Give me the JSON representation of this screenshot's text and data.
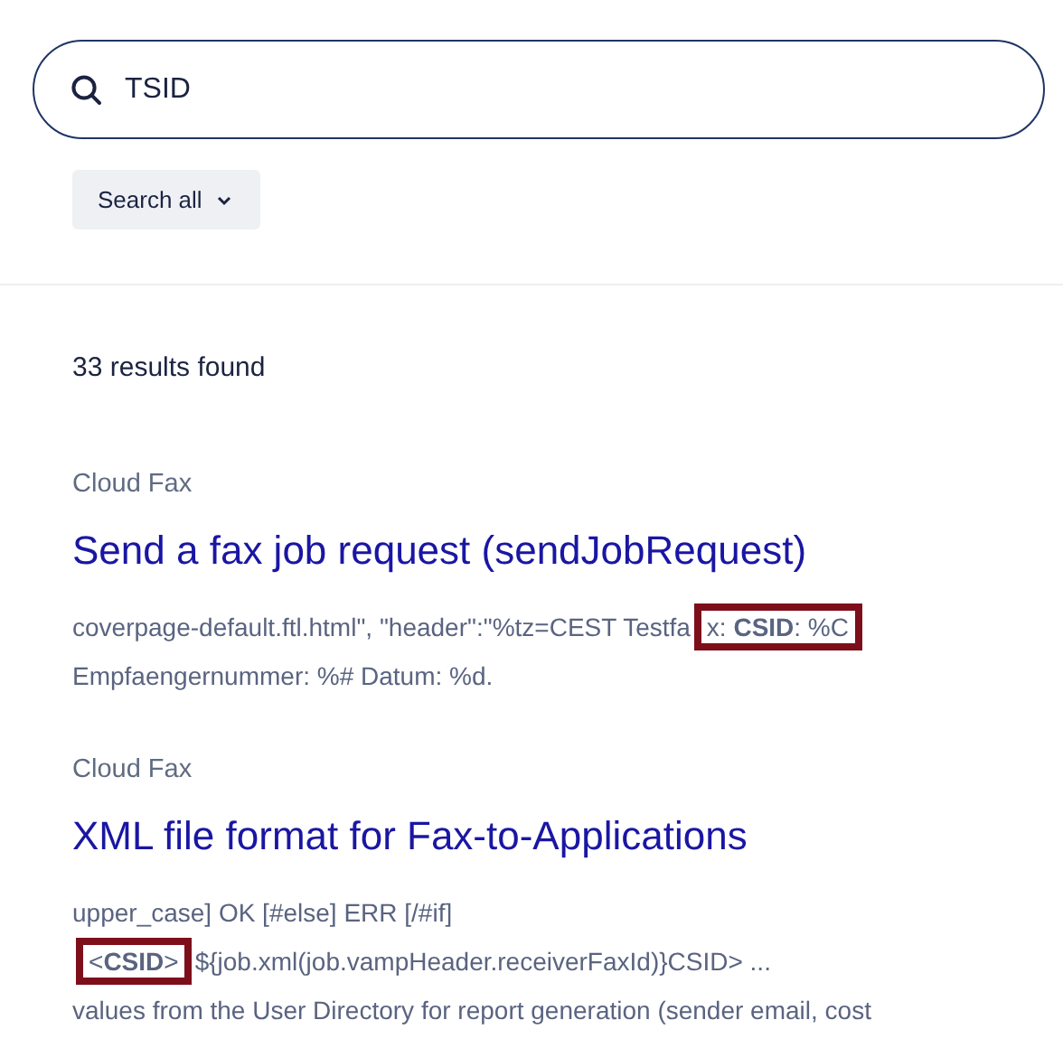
{
  "search": {
    "value": "TSID"
  },
  "scope_button": {
    "label": "Search all"
  },
  "result_count": "33 results found",
  "results": [
    {
      "category": "Cloud Fax",
      "title": "Send a fax job request (sendJobRequest)",
      "lines": [
        [
          {
            "text": "coverpage-default.ftl.html\", \"header\":\"%tz=CEST Testfa",
            "highlighted": false
          },
          {
            "text": "x: **CSID**: %C",
            "highlighted": true
          }
        ],
        [
          {
            "text": "Empfaengernummer: %# Datum: %d.",
            "highlighted": false
          }
        ]
      ]
    },
    {
      "category": "Cloud Fax",
      "title": "XML file format for Fax-to-Applications",
      "lines": [
        [
          {
            "text": "upper_case] OK [#else] ERR [/#if]",
            "highlighted": false
          }
        ],
        [
          {
            "text": "<**CSID**>",
            "highlighted": true
          },
          {
            "text": "${job.xml(job.vampHeader.receiverFaxId)}CSID> ...",
            "highlighted": false
          }
        ],
        [
          {
            "text": "values from the User Directory for report generation (sender email, cost",
            "highlighted": false
          }
        ]
      ]
    }
  ]
}
